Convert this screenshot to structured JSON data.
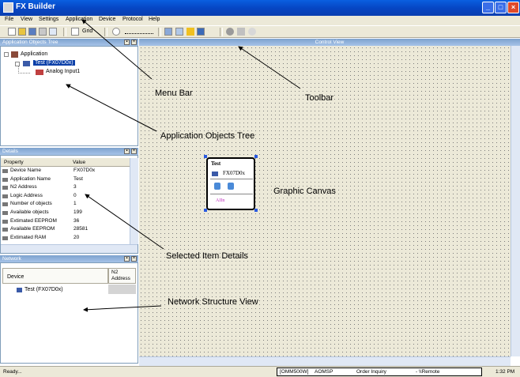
{
  "window": {
    "title": "FX Builder"
  },
  "menu": [
    "File",
    "View",
    "Settings",
    "Application",
    "Device",
    "Protocol",
    "Help"
  ],
  "toolbar": {
    "grid_label": "Grid"
  },
  "app_tree": {
    "header": "Application Objects Tree",
    "items": [
      "Application",
      "Test (FX07D0x)",
      "Analog Input1"
    ]
  },
  "details": {
    "header": "Details",
    "col_property": "Property",
    "col_value": "Value",
    "rows": [
      {
        "property": "Device Name",
        "value": "FX07D0x"
      },
      {
        "property": "Application Name",
        "value": "Test"
      },
      {
        "property": "N2 Address",
        "value": "3"
      },
      {
        "property": "Logic Address",
        "value": "0"
      },
      {
        "property": "Number of objects",
        "value": "1"
      },
      {
        "property": "Available objects",
        "value": "199"
      },
      {
        "property": "Extimated EEPROM",
        "value": "36"
      },
      {
        "property": "Available EEPROM",
        "value": "28581"
      },
      {
        "property": "Extimated RAM",
        "value": "20"
      }
    ]
  },
  "network": {
    "header": "Network",
    "col_device": "Device",
    "col_n2": "N2",
    "col_n2b": "Address",
    "row_device": "Test (FX07D0x)"
  },
  "control_view": {
    "header": "Control View",
    "device_card": {
      "title": "Test",
      "model": "FX07D0x",
      "obj": "AIIn"
    }
  },
  "status": {
    "left": "Ready...",
    "port": "[OMM500W]",
    "aomsp": "AOMSP",
    "inquiry": "Order Inquiry",
    "remote": "- \\\\Remote",
    "time": "1:32 PM"
  },
  "callouts": {
    "menu_bar": "Menu Bar",
    "toolbar": "Toolbar",
    "tree": "Application Objects Tree",
    "canvas": "Graphic Canvas",
    "details": "Selected Item Details",
    "network": "Network Structure View"
  }
}
